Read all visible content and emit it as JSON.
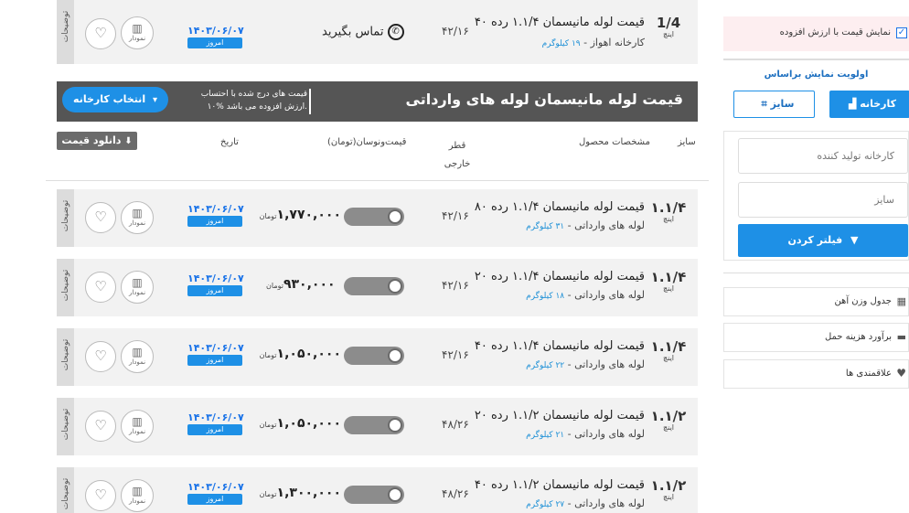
{
  "top_row": {
    "size": "1/4",
    "size_unit": "اینچ",
    "title": "قیمت لوله مانیسمان ۱.۱/۴ رده ۴۰",
    "factory": "کارخانه اهواز",
    "weight": "۱۹ کیلوگرم",
    "diameter": "۴۲/۱۶",
    "contact": "تماس بگیرید",
    "date": "۱۴۰۳/۰۶/۰۷",
    "today": "امروز",
    "chart_label": "نمودار",
    "desc_label": "توضیحات"
  },
  "section": {
    "heading": "قیمت لوله مانیسمان لوله های وارداتی",
    "vat_note_line1": "قیمت های درج شده با احتساب",
    "vat_note_line2": "۱۰% ارزش افزوده می باشد.",
    "factory_select": "انتخاب کارخانه",
    "download": "دانلود قیمت"
  },
  "columns": {
    "size": "سایز",
    "spec": "مشخصات محصول",
    "diameter": "قطر خارجی",
    "price": "قیمت‌ونوسان(تومان)",
    "date": "تاریخ"
  },
  "rows": [
    {
      "size": "۱.۱/۴",
      "unit": "اینچ",
      "title": "قیمت لوله مانیسمان ۱.۱/۴ رده ۸۰",
      "origin": "لوله های وارداتی -",
      "weight": "۳۱ کیلوگرم",
      "diameter": "۴۲/۱۶",
      "price": "۱,۷۷۰,۰۰۰",
      "currency": "تومان",
      "date": "۱۴۰۳/۰۶/۰۷",
      "today": "امروز",
      "chart": "نمودار",
      "desc": "توضیحات"
    },
    {
      "size": "۱.۱/۴",
      "unit": "اینچ",
      "title": "قیمت لوله مانیسمان ۱.۱/۴ رده ۲۰",
      "origin": "لوله های وارداتی -",
      "weight": "۱۸ کیلوگرم",
      "diameter": "۴۲/۱۶",
      "price": "۹۳۰,۰۰۰",
      "currency": "تومان",
      "date": "۱۴۰۳/۰۶/۰۷",
      "today": "امروز",
      "chart": "نمودار",
      "desc": "توضیحات"
    },
    {
      "size": "۱.۱/۴",
      "unit": "اینچ",
      "title": "قیمت لوله مانیسمان ۱.۱/۴ رده ۴۰",
      "origin": "لوله های وارداتی -",
      "weight": "۲۲ کیلوگرم",
      "diameter": "۴۲/۱۶",
      "price": "۱,۰۵۰,۰۰۰",
      "currency": "تومان",
      "date": "۱۴۰۳/۰۶/۰۷",
      "today": "امروز",
      "chart": "نمودار",
      "desc": "توضیحات"
    },
    {
      "size": "۱.۱/۲",
      "unit": "اینچ",
      "title": "قیمت لوله مانیسمان ۱.۱/۲ رده ۲۰",
      "origin": "لوله های وارداتی -",
      "weight": "۲۱ کیلوگرم",
      "diameter": "۴۸/۲۶",
      "price": "۱,۰۵۰,۰۰۰",
      "currency": "تومان",
      "date": "۱۴۰۳/۰۶/۰۷",
      "today": "امروز",
      "chart": "نمودار",
      "desc": "توضیحات"
    },
    {
      "size": "۱.۱/۲",
      "unit": "اینچ",
      "title": "قیمت لوله مانیسمان ۱.۱/۲ رده ۴۰",
      "origin": "لوله های وارداتی -",
      "weight": "۲۷ کیلوگرم",
      "diameter": "۴۸/۲۶",
      "price": "۱,۳۰۰,۰۰۰",
      "currency": "تومان",
      "date": "۱۴۰۳/۰۶/۰۷",
      "today": "امروز",
      "chart": "نمودار",
      "desc": "توضیحات"
    }
  ],
  "sidebar": {
    "vat_checkbox_label": "نمایش قیمت با ارزش افزوده",
    "vat_checked": true,
    "priority_title": "اولویت نمایش براساس",
    "factory_btn": "کارخانه",
    "size_btn": "سایز",
    "manufacturer_placeholder": "کارخانه تولید کننده",
    "size_placeholder": "سایز",
    "filter_btn": "فیلتر کردن",
    "links": [
      "جدول وزن آهن",
      "برآورد هزینه حمل",
      "علاقمندی ها"
    ]
  },
  "colors": {
    "accent": "#1e90e6",
    "header_bg": "#555555",
    "row_bg": "#f2f2f2",
    "vat_bg": "#fdeef0"
  }
}
